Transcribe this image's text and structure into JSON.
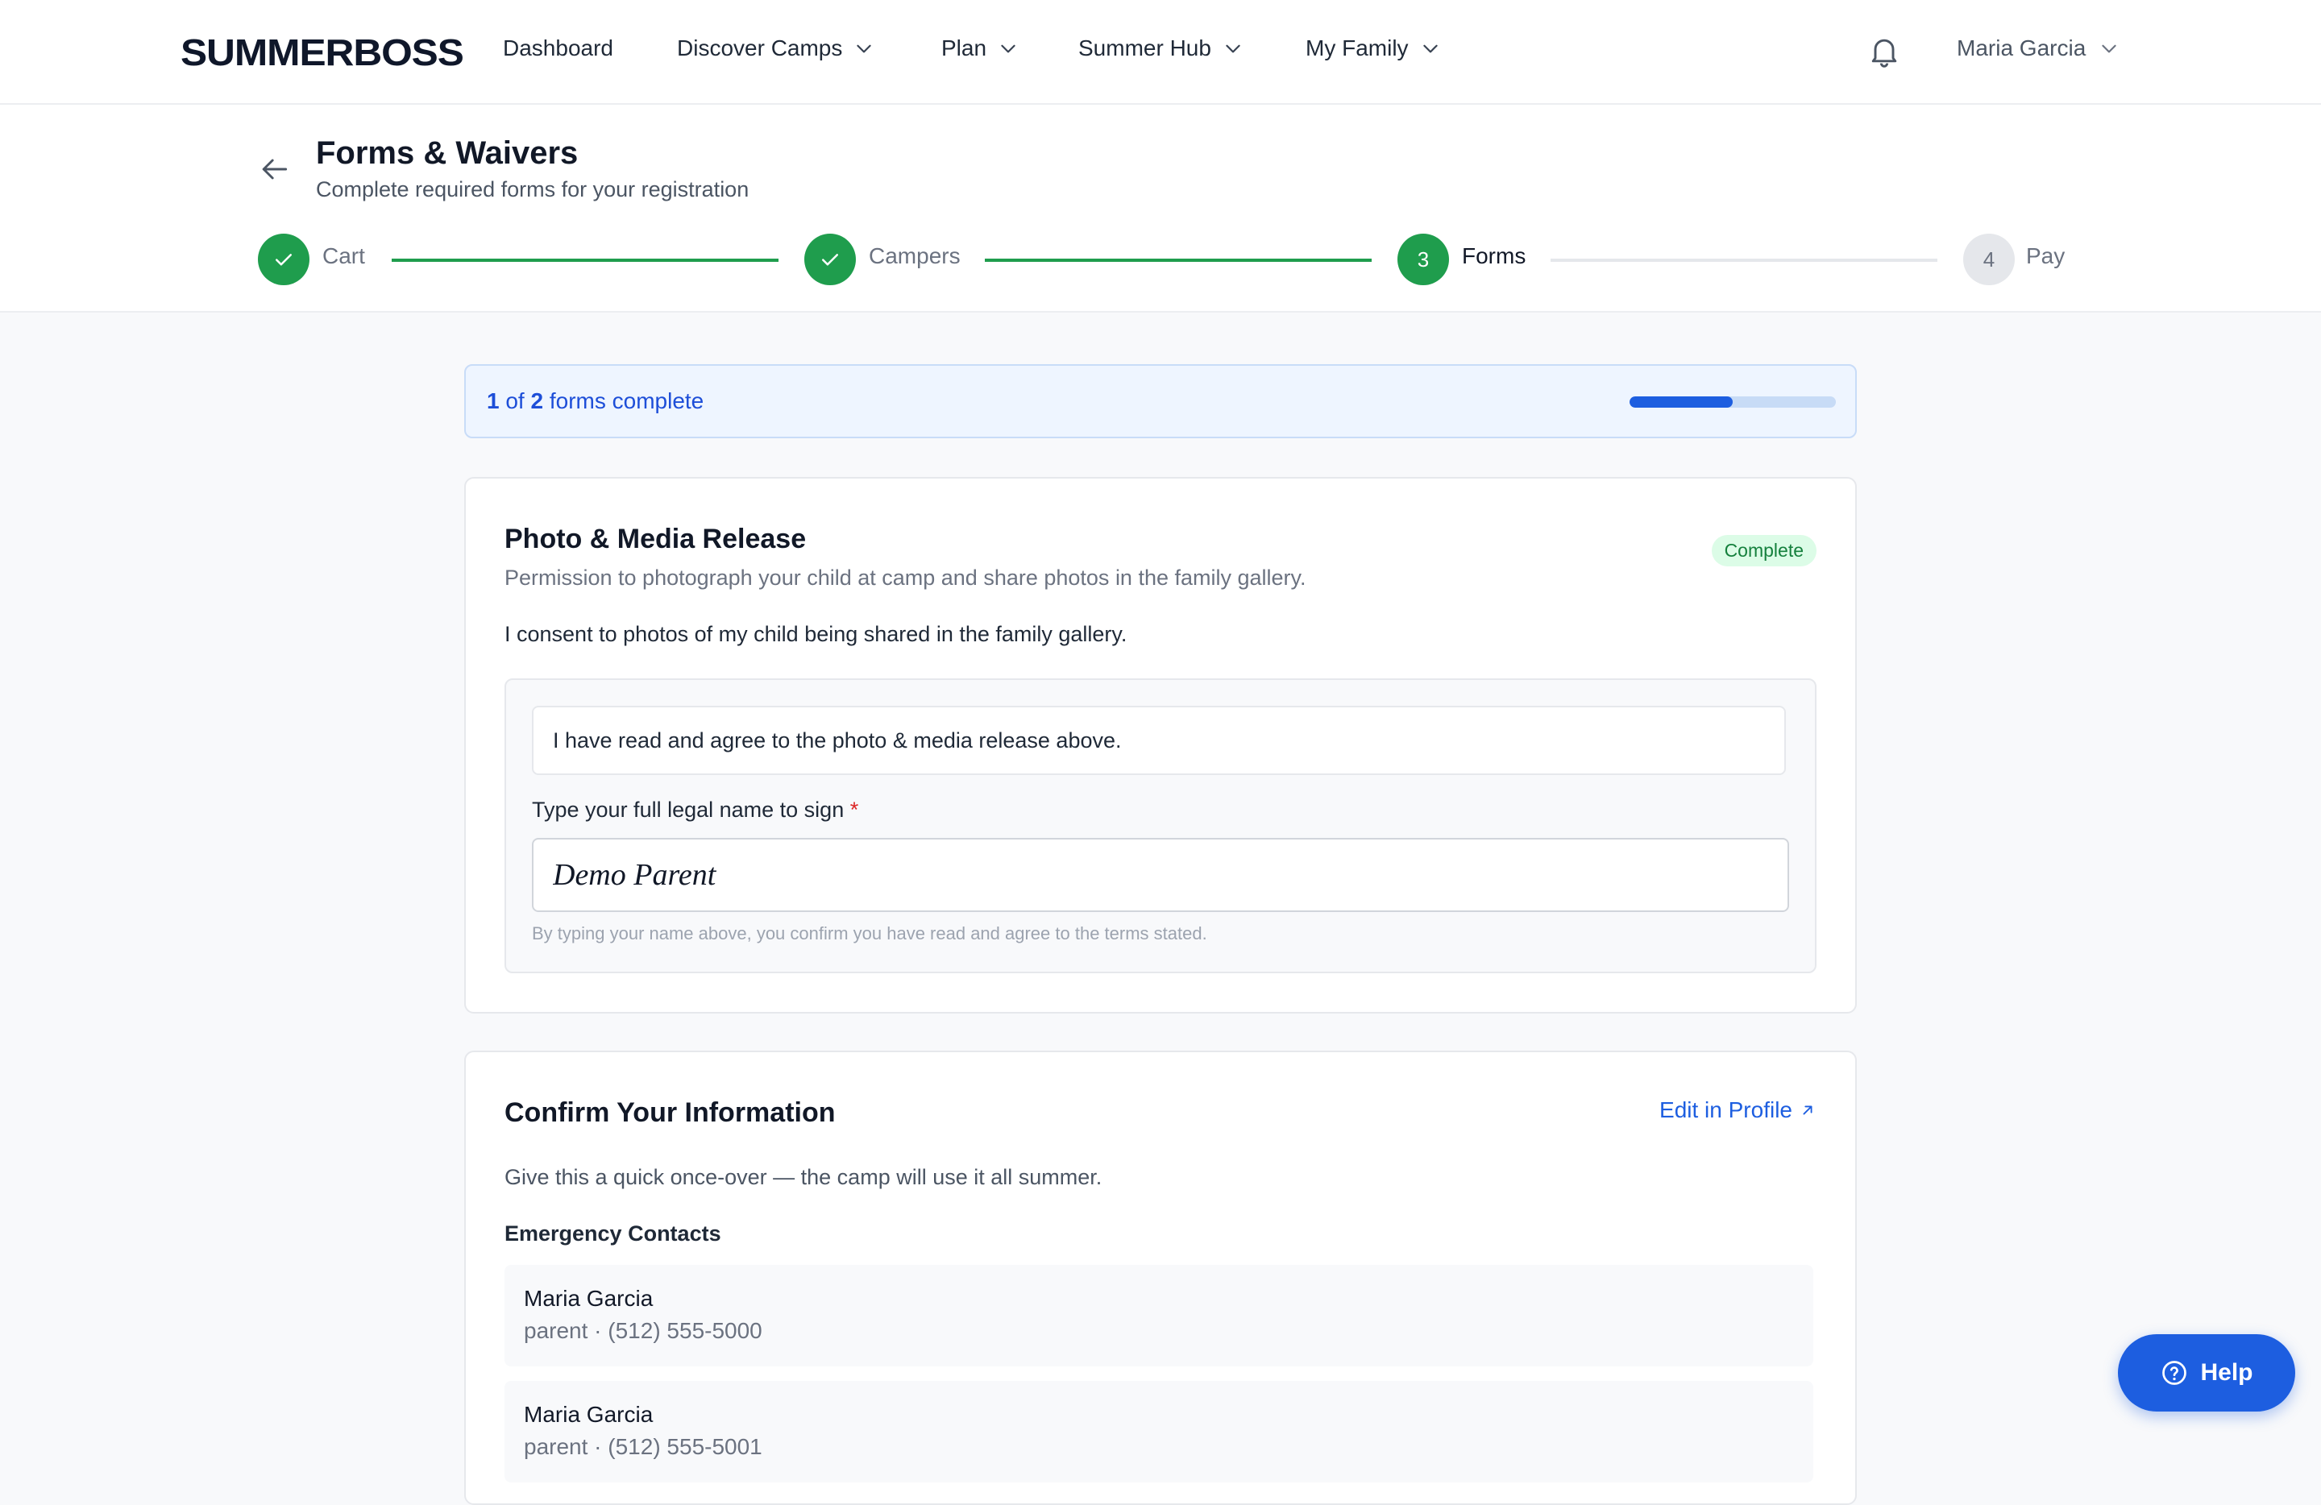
{
  "nav": {
    "logo": "SUMMERBOSS",
    "items": [
      {
        "label": "Dashboard",
        "has_menu": false
      },
      {
        "label": "Discover Camps",
        "has_menu": true
      },
      {
        "label": "Plan",
        "has_menu": true
      },
      {
        "label": "Summer Hub",
        "has_menu": true
      },
      {
        "label": "My Family",
        "has_menu": true
      }
    ],
    "user_name": "Maria Garcia",
    "icons": {
      "notifications": "bell-icon",
      "user_menu": "chevron-down-icon"
    }
  },
  "header": {
    "title": "Forms & Waivers",
    "subtitle": "Complete required forms for your registration",
    "back_icon": "arrow-left-icon"
  },
  "stepper": {
    "steps": [
      {
        "label": "Cart",
        "state": "done",
        "number": "1"
      },
      {
        "label": "Campers",
        "state": "done",
        "number": "2"
      },
      {
        "label": "Forms",
        "state": "active",
        "number": "3"
      },
      {
        "label": "Pay",
        "state": "todo",
        "number": "4"
      }
    ]
  },
  "progress": {
    "completed": "1",
    "of_text": " of ",
    "total": "2",
    "suffix": " forms complete",
    "fraction": 0.5
  },
  "photo_release": {
    "title": "Photo & Media Release",
    "description": "Permission to photograph your child at camp and share photos in the family gallery.",
    "status": "Complete",
    "consent_text": "I consent to photos of my child being shared in the family gallery.",
    "agree_text": "I have read and agree to the photo & media release above.",
    "sign_label": "Type your full legal name to sign",
    "required_mark": "*",
    "signature_value": "Demo Parent",
    "sign_hint": "By typing your name above, you confirm you have read and agree to the terms stated."
  },
  "confirm_info": {
    "title": "Confirm Your Information",
    "edit_link": "Edit in Profile",
    "description": "Give this a quick once-over — the camp will use it all summer.",
    "emergency_label": "Emergency Contacts",
    "contacts": [
      {
        "name": "Maria Garcia",
        "meta": "parent · (512) 555-5000"
      },
      {
        "name": "Maria Garcia",
        "meta": "parent · (512) 555-5001"
      }
    ]
  },
  "help": {
    "label": "Help",
    "icon": "question-circle-icon"
  },
  "colors": {
    "accent_green": "#1f9d4d",
    "accent_blue": "#1d5ee0",
    "badge_bg": "#dcfce7"
  }
}
